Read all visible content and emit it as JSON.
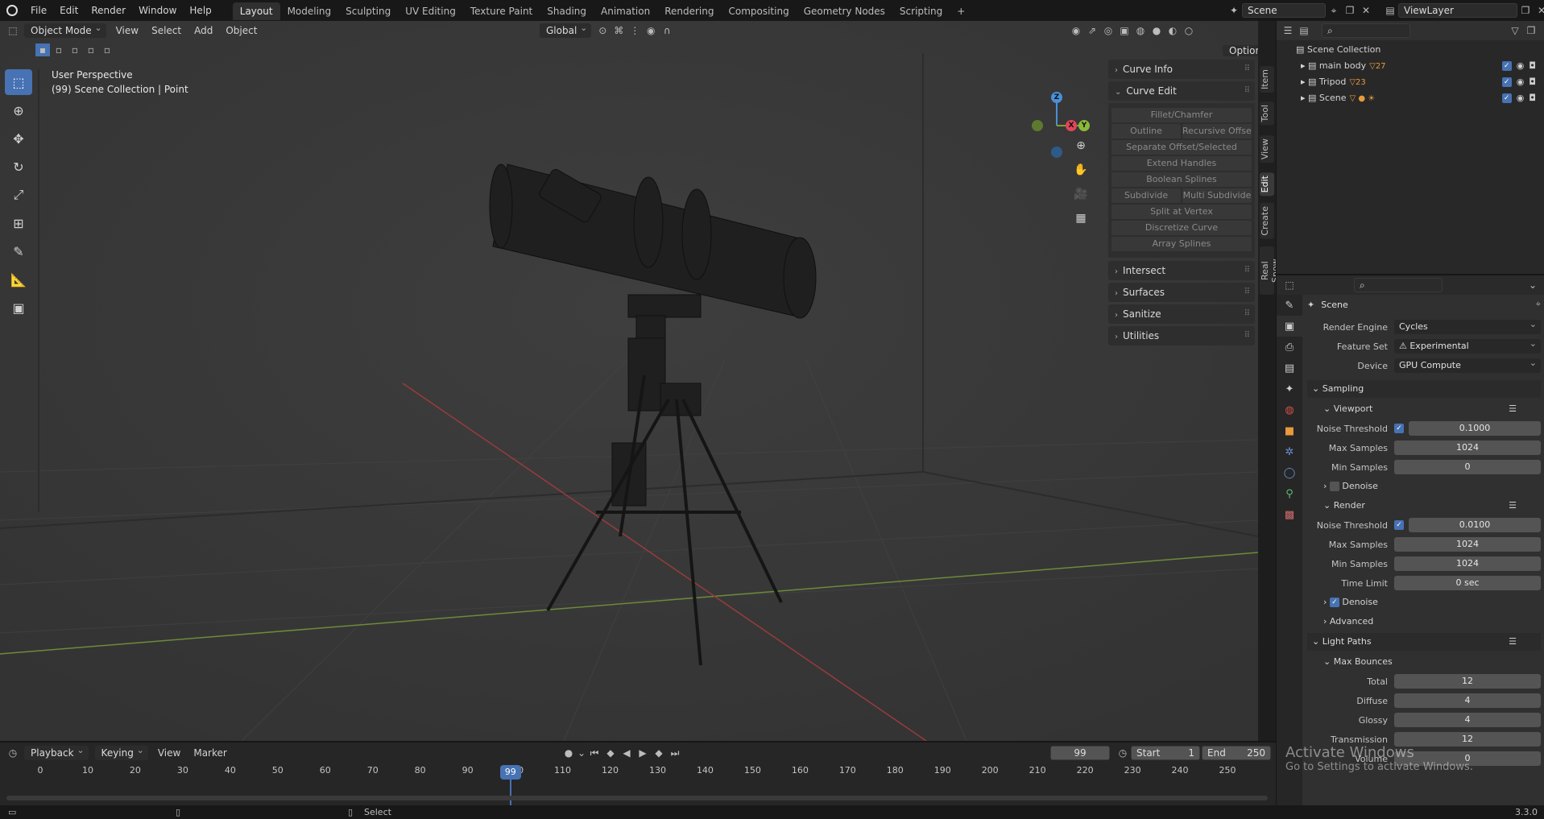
{
  "topbar": {
    "menus": [
      "File",
      "Edit",
      "Render",
      "Window",
      "Help"
    ],
    "workspaces": [
      "Layout",
      "Modeling",
      "Sculpting",
      "UV Editing",
      "Texture Paint",
      "Shading",
      "Animation",
      "Rendering",
      "Compositing",
      "Geometry Nodes",
      "Scripting"
    ],
    "active_workspace": "Layout",
    "add_tab": "+",
    "scene_name": "Scene",
    "view_layer": "ViewLayer"
  },
  "viewport": {
    "mode": "Object Mode",
    "menus": [
      "View",
      "Select",
      "Add",
      "Object"
    ],
    "orientation": "Global",
    "options_label": "Options",
    "info_line1": "User Perspective",
    "info_line2": "(99) Scene Collection | Point",
    "gizmo": {
      "z": "Z",
      "x": "X",
      "y": "Y"
    }
  },
  "npanel": {
    "sections": [
      {
        "label": "Curve Info",
        "expanded": false
      },
      {
        "label": "Curve Edit",
        "expanded": true
      }
    ],
    "curve_edit_buttons": {
      "fillet": "Fillet/Chamfer",
      "outline": "Outline",
      "recursive_offset": "Recursive Offset",
      "separate_offset": "Separate Offset/Selected",
      "extend_handles": "Extend Handles",
      "boolean_splines": "Boolean Splines",
      "subdivide": "Subdivide",
      "multi_subdivide": "Multi Subdivide",
      "split_at_vertex": "Split at Vertex",
      "discretize_curve": "Discretize Curve",
      "array_splines": "Array Splines"
    },
    "more_sections": [
      "Intersect",
      "Surfaces",
      "Sanitize",
      "Utilities"
    ],
    "vertical_tabs": [
      "Item",
      "Tool",
      "View",
      "Edit",
      "Create",
      "Real Snow"
    ],
    "active_tab": "Edit"
  },
  "outliner": {
    "root": "Scene Collection",
    "items": [
      {
        "name": "main body",
        "badge": "27"
      },
      {
        "name": "Tripod",
        "badge": "23"
      },
      {
        "name": "Scene",
        "badge": ""
      }
    ]
  },
  "properties": {
    "scene_label": "Scene",
    "render_engine_label": "Render Engine",
    "render_engine": "Cycles",
    "feature_set_label": "Feature Set",
    "feature_set": "Experimental",
    "device_label": "Device",
    "device": "GPU Compute",
    "sampling": "Sampling",
    "viewport": {
      "title": "Viewport",
      "noise_threshold_label": "Noise Threshold",
      "noise_threshold": "0.1000",
      "max_samples_label": "Max Samples",
      "max_samples": "1024",
      "min_samples_label": "Min Samples",
      "min_samples": "0",
      "denoise": "Denoise"
    },
    "render": {
      "title": "Render",
      "noise_threshold_label": "Noise Threshold",
      "noise_threshold": "0.0100",
      "max_samples_label": "Max Samples",
      "max_samples": "1024",
      "min_samples_label": "Min Samples",
      "min_samples": "1024",
      "time_limit_label": "Time Limit",
      "time_limit": "0 sec",
      "denoise": "Denoise"
    },
    "advanced": "Advanced",
    "light_paths": "Light Paths",
    "max_bounces": "Max Bounces",
    "bounces": [
      {
        "label": "Total",
        "value": "12"
      },
      {
        "label": "Diffuse",
        "value": "4"
      },
      {
        "label": "Glossy",
        "value": "4"
      },
      {
        "label": "Transmission",
        "value": "12"
      },
      {
        "label": "Volume",
        "value": "0"
      }
    ]
  },
  "timeline": {
    "menus": [
      "Playback",
      "Keying",
      "View",
      "Marker"
    ],
    "current_frame": "99",
    "start_label": "Start",
    "start": "1",
    "end_label": "End",
    "end": "250",
    "ticks": [
      "0",
      "10",
      "20",
      "30",
      "40",
      "50",
      "60",
      "70",
      "80",
      "90",
      "100",
      "110",
      "120",
      "130",
      "140",
      "150",
      "160",
      "170",
      "180",
      "190",
      "200",
      "210",
      "220",
      "230",
      "240",
      "250"
    ]
  },
  "statusbar": {
    "select": "Select",
    "version": "3.3.0"
  },
  "watermark": {
    "line1": "Activate Windows",
    "line2": "Go to Settings to activate Windows."
  }
}
